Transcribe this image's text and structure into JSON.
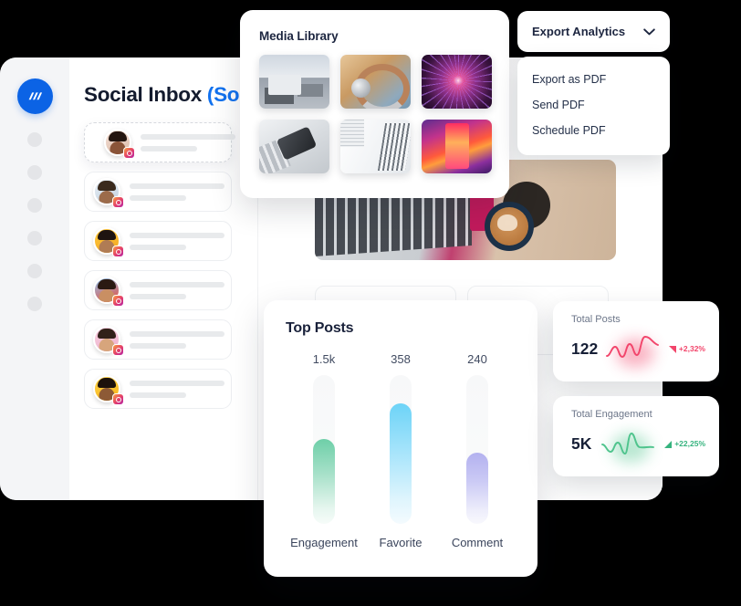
{
  "app": {
    "logo_icon": "app-logo-icon",
    "nav_dot_count": 6
  },
  "inbox": {
    "title_main": "Social Inbox ",
    "title_badge": "(Soon)",
    "items": [
      {
        "avatar_icon": "avatar-person-1",
        "badge_icon": "instagram-badge-icon"
      },
      {
        "avatar_icon": "avatar-person-2",
        "badge_icon": "instagram-badge-icon"
      },
      {
        "avatar_icon": "avatar-person-3",
        "badge_icon": "instagram-badge-icon"
      },
      {
        "avatar_icon": "avatar-person-4",
        "badge_icon": "instagram-badge-icon"
      },
      {
        "avatar_icon": "avatar-person-5",
        "badge_icon": "instagram-badge-icon"
      },
      {
        "avatar_icon": "avatar-person-6",
        "badge_icon": "instagram-badge-icon"
      }
    ]
  },
  "media_library": {
    "title": "Media Library",
    "thumbnails": [
      {
        "name": "desk-monitor-photo"
      },
      {
        "name": "headphones-photo"
      },
      {
        "name": "plasma-neuron-photo"
      },
      {
        "name": "laptop-phone-photo"
      },
      {
        "name": "white-architecture-photo"
      },
      {
        "name": "neon-corridor-photo"
      }
    ]
  },
  "feed": {
    "network_icon": "twitter-icon",
    "post_image_name": "laptop-coffee-photo"
  },
  "export": {
    "button_label": "Export Analytics",
    "chevron_icon": "chevron-down-icon",
    "menu_items": [
      "Export as PDF",
      "Send PDF",
      "Schedule PDF"
    ]
  },
  "chart_data": {
    "type": "bar",
    "title": "Top Posts",
    "categories": [
      "Engagement",
      "Favorite",
      "Comment"
    ],
    "value_labels": [
      "1.5k",
      "358",
      "240"
    ],
    "values": [
      1500,
      358,
      240
    ],
    "fill_percents": [
      57,
      81,
      48
    ],
    "colors": [
      "#6ecfa8",
      "#6cd3f7",
      "#b3b1ef"
    ],
    "xlabel": "",
    "ylabel": "",
    "grid": false,
    "legend": "none"
  },
  "stats": [
    {
      "label": "Total Posts",
      "value": "122",
      "trend": "+2,32%",
      "trend_direction": "down",
      "trend_color": "#f2456b",
      "spark_color": "#f2456b",
      "spark_icon": "sparkline-icon",
      "arrow_icon": "trend-down-icon"
    },
    {
      "label": "Total Engagement",
      "value": "5K",
      "trend": "+22,25%",
      "trend_direction": "up",
      "trend_color": "#35b37e",
      "spark_color": "#4fc48d",
      "spark_icon": "sparkline-icon",
      "arrow_icon": "trend-up-icon"
    }
  ],
  "theme": {
    "accent_blue": "#0b63e5",
    "background": "#000000",
    "surface": "#ffffff",
    "sidebar": "#f4f5f7",
    "text_dark": "#19213a",
    "text_muted": "#6c7689"
  }
}
